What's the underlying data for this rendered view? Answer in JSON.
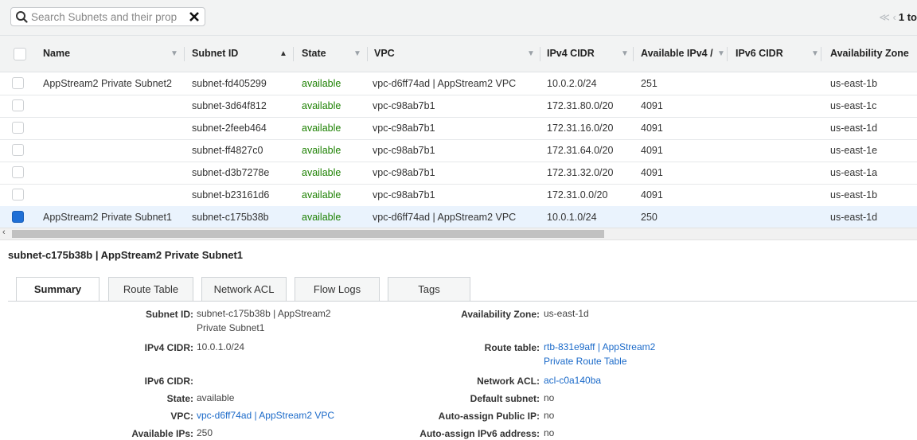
{
  "search": {
    "placeholder": "Search Subnets and their prop"
  },
  "pager": {
    "arrows": "≪ ‹",
    "count": "1 to"
  },
  "columns": [
    {
      "key": "name",
      "label": "Name"
    },
    {
      "key": "subnet_id",
      "label": "Subnet ID"
    },
    {
      "key": "state",
      "label": "State"
    },
    {
      "key": "vpc",
      "label": "VPC"
    },
    {
      "key": "ipv4_cidr",
      "label": "IPv4 CIDR"
    },
    {
      "key": "available_ipv4",
      "label": "Available IPv4 /"
    },
    {
      "key": "ipv6_cidr",
      "label": "IPv6 CIDR"
    },
    {
      "key": "az",
      "label": "Availability Zone"
    }
  ],
  "rows": [
    {
      "name": "AppStream2 Private Subnet2",
      "subnet_id": "subnet-fd405299",
      "state": "available",
      "vpc": "vpc-d6ff74ad | AppStream2 VPC",
      "ipv4_cidr": "10.0.2.0/24",
      "available_ipv4": "251",
      "ipv6_cidr": "",
      "az": "us-east-1b",
      "selected": false
    },
    {
      "name": "",
      "subnet_id": "subnet-3d64f812",
      "state": "available",
      "vpc": "vpc-c98ab7b1",
      "ipv4_cidr": "172.31.80.0/20",
      "available_ipv4": "4091",
      "ipv6_cidr": "",
      "az": "us-east-1c",
      "selected": false
    },
    {
      "name": "",
      "subnet_id": "subnet-2feeb464",
      "state": "available",
      "vpc": "vpc-c98ab7b1",
      "ipv4_cidr": "172.31.16.0/20",
      "available_ipv4": "4091",
      "ipv6_cidr": "",
      "az": "us-east-1d",
      "selected": false
    },
    {
      "name": "",
      "subnet_id": "subnet-ff4827c0",
      "state": "available",
      "vpc": "vpc-c98ab7b1",
      "ipv4_cidr": "172.31.64.0/20",
      "available_ipv4": "4091",
      "ipv6_cidr": "",
      "az": "us-east-1e",
      "selected": false
    },
    {
      "name": "",
      "subnet_id": "subnet-d3b7278e",
      "state": "available",
      "vpc": "vpc-c98ab7b1",
      "ipv4_cidr": "172.31.32.0/20",
      "available_ipv4": "4091",
      "ipv6_cidr": "",
      "az": "us-east-1a",
      "selected": false
    },
    {
      "name": "",
      "subnet_id": "subnet-b23161d6",
      "state": "available",
      "vpc": "vpc-c98ab7b1",
      "ipv4_cidr": "172.31.0.0/20",
      "available_ipv4": "4091",
      "ipv6_cidr": "",
      "az": "us-east-1b",
      "selected": false
    },
    {
      "name": "AppStream2 Private Subnet1",
      "subnet_id": "subnet-c175b38b",
      "state": "available",
      "vpc": "vpc-d6ff74ad | AppStream2 VPC",
      "ipv4_cidr": "10.0.1.0/24",
      "available_ipv4": "250",
      "ipv6_cidr": "",
      "az": "us-east-1d",
      "selected": true
    }
  ],
  "detail": {
    "title": "subnet-c175b38b | AppStream2 Private Subnet1",
    "tabs": [
      "Summary",
      "Route Table",
      "Network ACL",
      "Flow Logs",
      "Tags"
    ],
    "active_tab": "Summary",
    "left": [
      {
        "label": "Subnet ID:",
        "value": "subnet-c175b38b | AppStream2 Private Subnet1",
        "link": false
      },
      {
        "label": "IPv4 CIDR:",
        "value": "10.0.1.0/24",
        "link": false
      },
      {
        "label": "IPv6 CIDR:",
        "value": "",
        "link": false
      },
      {
        "label": "State:",
        "value": "available",
        "link": false
      },
      {
        "label": "VPC:",
        "value": "vpc-d6ff74ad | AppStream2 VPC",
        "link": true
      },
      {
        "label": "Available IPs:",
        "value": "250",
        "link": false
      }
    ],
    "right": [
      {
        "label": "Availability Zone:",
        "value": "us-east-1d",
        "link": false
      },
      {
        "label": "Route table:",
        "value": "rtb-831e9aff | AppStream2 Private Route Table",
        "link": true
      },
      {
        "label": "Network ACL:",
        "value": "acl-c0a140ba",
        "link": true
      },
      {
        "label": "Default subnet:",
        "value": "no",
        "link": false
      },
      {
        "label": "Auto-assign Public IP:",
        "value": "no",
        "link": false
      },
      {
        "label": "Auto-assign IPv6 address:",
        "value": "no",
        "link": false
      }
    ]
  },
  "colors": {
    "selected_checkbox": "#1f6fd6",
    "available": "#1d8102",
    "link": "#1b6ac9",
    "header_bg": "#f2f3f3"
  },
  "icons": {
    "search": "search-icon",
    "clear": "close-icon",
    "pager": "pagination-arrows-icon"
  }
}
